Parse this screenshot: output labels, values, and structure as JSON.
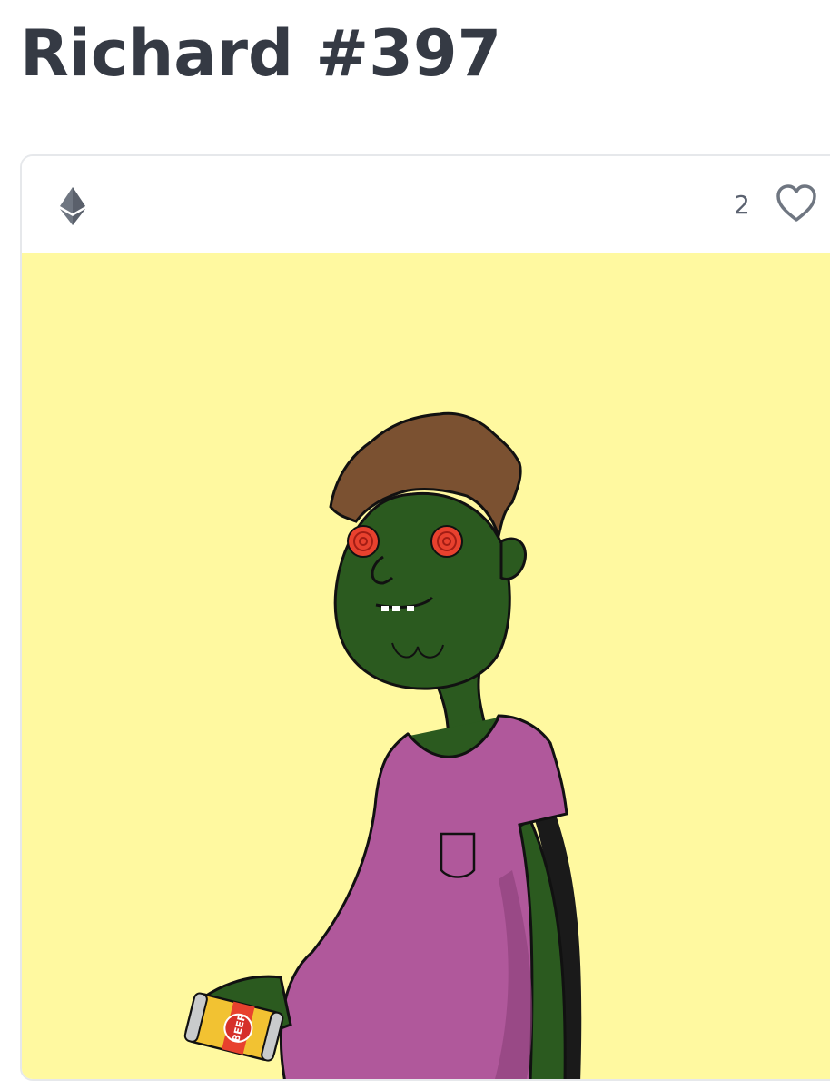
{
  "page": {
    "title": "Richard #397"
  },
  "card": {
    "chain_icon": "ethereum-icon",
    "like_count": "2",
    "like_icon": "heart-outline-icon",
    "artwork_background": "#fff9a0",
    "artwork_can_label": "BEER"
  },
  "colors": {
    "title": "#353a44",
    "skin": "#2b5a1f",
    "hair": "#7b5131",
    "shirt": "#b0589b",
    "eyes": "#e8412e",
    "can": "#f2c232"
  }
}
